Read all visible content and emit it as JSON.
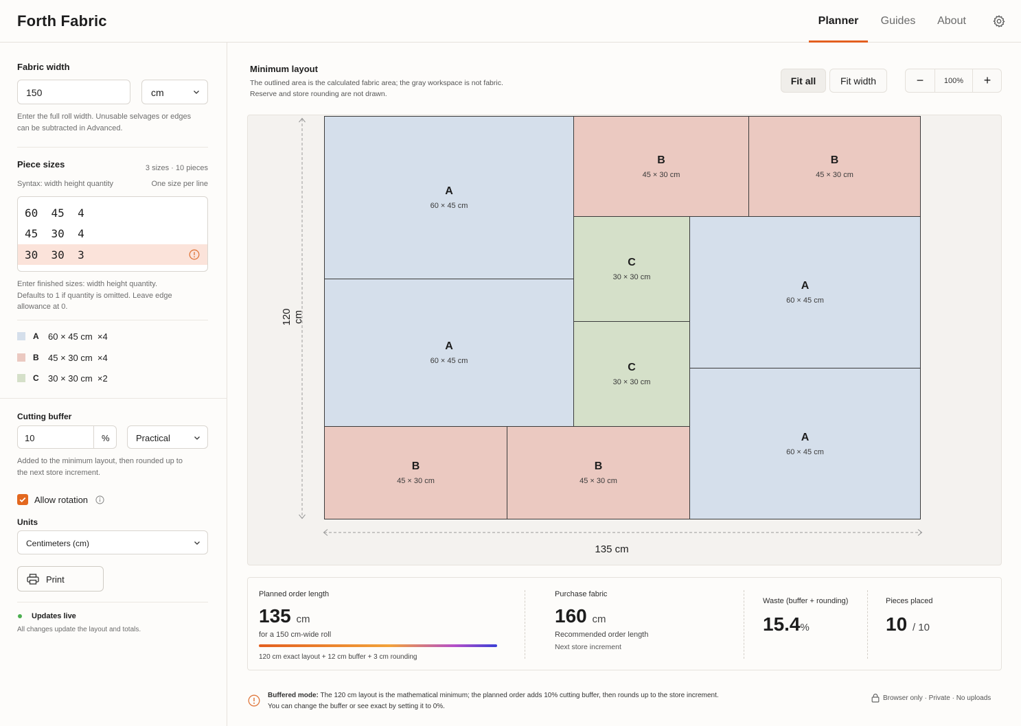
{
  "app": {
    "brand": "Forth Fabric"
  },
  "nav": {
    "planner": "Planner",
    "guides": "Guides",
    "about": "About"
  },
  "fabric_width": {
    "label": "Fabric width",
    "value": "150",
    "unit": "cm",
    "help_line1": "Enter the full roll width. Unusable selvages or edges",
    "help_line2": "can be subtracted in Advanced."
  },
  "piece_sizes": {
    "label": "Piece sizes",
    "summary": "3 sizes · 10 pieces",
    "syntax": "Syntax: width height quantity",
    "per_line": "One size per line",
    "lines": [
      "60  45  4",
      "45  30  4",
      "30  30  3"
    ],
    "help_line1": "Enter finished sizes: width height quantity.",
    "help_line2": "Defaults to 1 if quantity is omitted. Leave edge",
    "help_line3": "allowance at 0."
  },
  "legend": [
    {
      "letter": "A",
      "text": "60 × 45 cm  ×4",
      "color": "#d5dfeb"
    },
    {
      "letter": "B",
      "text": "45 × 30 cm  ×4",
      "color": "#ebc9c1"
    },
    {
      "letter": "C",
      "text": "30 × 30 cm  ×2",
      "color": "#d5e0c9"
    }
  ],
  "cutting_buffer": {
    "label": "Cutting buffer",
    "value": "10",
    "unit": "%",
    "mode": "Practical",
    "help_line1": "Added to the minimum layout, then rounded up to",
    "help_line2": "the next store increment."
  },
  "rotation": {
    "label": "Allow rotation",
    "checked": true
  },
  "units": {
    "label": "Units",
    "value": "Centimeters (cm)"
  },
  "print_label": "Print",
  "live": {
    "title": "Updates live",
    "desc": "All changes update the layout and totals."
  },
  "layout": {
    "title": "Minimum layout",
    "desc_line1": "The outlined area is the calculated fabric area; the gray workspace is not fabric.",
    "desc_line2": "Reserve and store rounding are not drawn.",
    "fit_all": "Fit all",
    "fit_width": "Fit width",
    "zoom": "100%",
    "zoom_out": "−",
    "zoom_in": "+",
    "height_label": "120 cm",
    "width_label": "135 cm",
    "pieces": [
      {
        "letter": "A",
        "size": "60 × 45 cm"
      },
      {
        "letter": "A",
        "size": "60 × 45 cm"
      },
      {
        "letter": "B",
        "size": "45 × 30 cm"
      },
      {
        "letter": "B",
        "size": "45 × 30 cm"
      },
      {
        "letter": "C",
        "size": "30 × 30 cm"
      },
      {
        "letter": "C",
        "size": "30 × 30 cm"
      },
      {
        "letter": "A",
        "size": "60 × 45 cm"
      },
      {
        "letter": "A",
        "size": "60 × 45 cm"
      },
      {
        "letter": "B",
        "size": "45 × 30 cm"
      },
      {
        "letter": "B",
        "size": "45 × 30 cm"
      }
    ]
  },
  "stats": {
    "planned_label": "Planned order length",
    "planned_value": "135",
    "planned_unit": "cm",
    "planned_sub": "for a 150 cm-wide roll",
    "planned_breakdown": "120 cm exact layout + 12 cm buffer + 3 cm rounding",
    "purchase_label": "Purchase fabric",
    "purchase_value": "160",
    "purchase_unit": "cm",
    "purchase_sub1": "Recommended order length",
    "purchase_sub2": "Next store increment",
    "waste_label": "Waste (buffer + rounding)",
    "waste_value": "15.4",
    "waste_unit": "%",
    "pieces_label": "Pieces placed",
    "pieces_value": "10",
    "pieces_total": "/ 10"
  },
  "footer": {
    "mode_label": "Buffered mode:",
    "mode_text": "The 120 cm layout is the mathematical minimum; the planned order adds 10% cutting buffer, then rounds up to the store increment.",
    "mode_text2": "You can change the buffer or see exact by setting it to 0%.",
    "privacy": "Browser only · Private · No uploads"
  }
}
